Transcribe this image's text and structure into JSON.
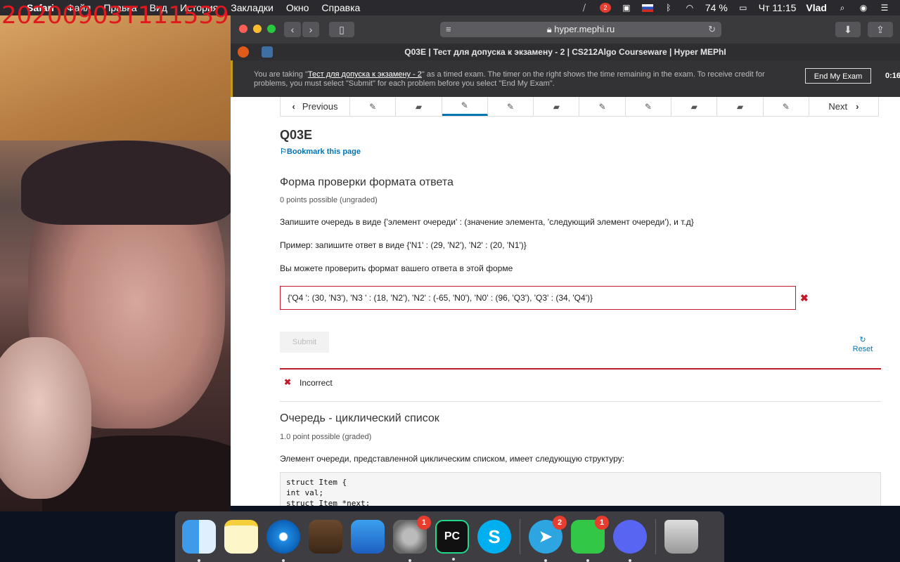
{
  "menubar": {
    "apple": "",
    "app": "Safari",
    "items": [
      "Файл",
      "Правка",
      "Вид",
      "История",
      "Закладки",
      "Окно",
      "Справка"
    ],
    "battery": "74 %",
    "clock": "Чт 11:15",
    "user": "Vlad",
    "notification_count": "2"
  },
  "webcam": {
    "timestamp": "20200903T111539"
  },
  "browser": {
    "url": "hyper.mephi.ru",
    "tab_title": "Q03E | Тест для допуска к экзамену - 2 | CS212Algo Courseware | Hyper MEPhI"
  },
  "exam_banner": {
    "text_before": "You are taking \"",
    "exam_name": "Тест для допуска к экзамену - 2",
    "text_after": "\" as a timed exam. The timer on the right shows the time remaining in the exam. To receive credit for problems, you must select \"Submit\" for each problem before you select \"End My Exam\".",
    "end_button": "End My Exam",
    "timer": "0:16:"
  },
  "seq_nav": {
    "previous": "Previous",
    "next": "Next",
    "active_index": 2,
    "unit_icons": [
      "edit",
      "book",
      "edit",
      "edit",
      "book",
      "edit",
      "edit",
      "book",
      "book",
      "edit"
    ]
  },
  "page": {
    "title": "Q03E",
    "bookmark": "Bookmark this page"
  },
  "problem1": {
    "title": "Форма проверки формата ответа",
    "points": "0 points possible (ungraded)",
    "p1": "Запишите очередь в виде {'элемент очереди' : (значение элемента, 'следующий элемент очереди'), и т.д}",
    "p2": "Пример: запишите ответ в виде {'N1' : (29, 'N2'), 'N2' : (20, 'N1')}",
    "p3": "Вы можете проверить формат вашего ответа в этой форме",
    "answer": "{'Q4 ': (30, 'N3'), 'N3 ' : (18, 'N2'), 'N2' : (-65, 'N0'), 'N0' : (96, 'Q3'), 'Q3' : (34, 'Q4')}",
    "submit": "Submit",
    "reset": "Reset",
    "status": "Incorrect"
  },
  "problem2": {
    "title": "Очередь - циклический список",
    "points": "1.0 point possible (graded)",
    "p1": "Элемент очереди, представленной циклическим списком, имеет следующую структуру:",
    "code": "struct Item {\nint val;\nstruct Item *next;"
  },
  "dock": {
    "telegram_badge": "2",
    "facetime_badge": "1",
    "sysprefs_badge": "1"
  },
  "colors": {
    "accent": "#0075b4",
    "error": "#c11a2b",
    "exam_bar": "#333335",
    "timestamp": "#e0191f"
  }
}
